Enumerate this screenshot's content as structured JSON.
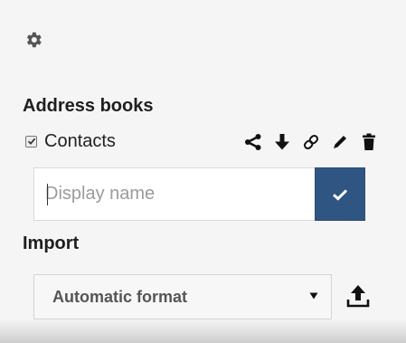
{
  "address_books": {
    "title": "Address books",
    "items": [
      {
        "label": "Contacts",
        "checked": true
      }
    ],
    "actions": [
      {
        "name": "share",
        "icon": "share-icon"
      },
      {
        "name": "download",
        "icon": "download-icon"
      },
      {
        "name": "link",
        "icon": "link-icon"
      },
      {
        "name": "rename",
        "icon": "pencil-icon"
      },
      {
        "name": "delete",
        "icon": "trash-icon"
      }
    ],
    "new_book": {
      "placeholder": "Display name",
      "value": "",
      "confirm_icon": "checkmark-icon"
    }
  },
  "import": {
    "title": "Import",
    "format_selected": "Automatic format",
    "upload_icon": "upload-icon"
  },
  "settings_icon": "gear-icon",
  "colors": {
    "background": "#f5f5f5",
    "confirm_button": "#2f5683",
    "text": "#222222",
    "placeholder": "#9b9b9b"
  }
}
